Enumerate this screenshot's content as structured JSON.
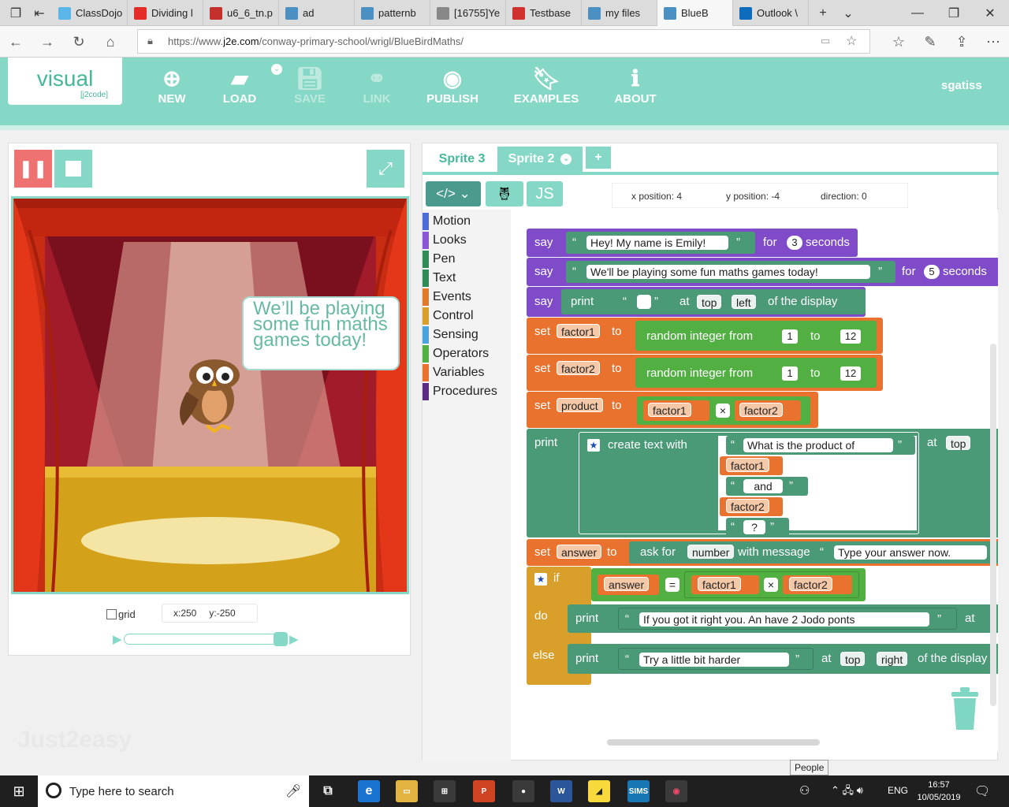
{
  "browser": {
    "tabs": [
      {
        "label": "ClassDojo",
        "icon": "classdojo-icon",
        "color": "#5ab6e8"
      },
      {
        "label": "Dividing l",
        "icon": "youtube-icon",
        "color": "#e52d27"
      },
      {
        "label": "u6_6_tn.p",
        "icon": "pdf-icon",
        "color": "#c4302b"
      },
      {
        "label": "ad",
        "icon": "j2e-icon",
        "color": "#4a90c2"
      },
      {
        "label": "patternb",
        "icon": "j2e-icon",
        "color": "#4a90c2"
      },
      {
        "label": "[16755]Ye",
        "icon": "page-icon",
        "color": "#888888"
      },
      {
        "label": "Testbase",
        "icon": "testbase-icon",
        "color": "#d0312d"
      },
      {
        "label": "my files",
        "icon": "j2e-icon",
        "color": "#4a90c2"
      },
      {
        "label": "BlueB",
        "icon": "j2e-icon",
        "color": "#4a90c2"
      },
      {
        "label": "Outlook \\",
        "icon": "outlook-icon",
        "color": "#0f6cbd"
      }
    ],
    "url_prefix": "https://www.",
    "url_domain": "j2e.com",
    "url_path": "/conway-primary-school/wrigl/BlueBirdMaths/"
  },
  "app": {
    "logo_main": "visual",
    "logo_sub": "[j2code]",
    "nav": [
      {
        "label": "NEW",
        "icon": "plus-circle-icon",
        "enabled": true
      },
      {
        "label": "LOAD",
        "icon": "folder-icon",
        "enabled": true
      },
      {
        "label": "SAVE",
        "icon": "save-icon",
        "enabled": false
      },
      {
        "label": "LINK",
        "icon": "link-icon",
        "enabled": false
      },
      {
        "label": "PUBLISH",
        "icon": "publish-icon",
        "enabled": true
      },
      {
        "label": "EXAMPLES",
        "icon": "bookmark-icon",
        "enabled": true
      },
      {
        "label": "ABOUT",
        "icon": "info-icon",
        "enabled": true
      }
    ],
    "username": "sgatiss",
    "accent": "#84d8c5"
  },
  "stage": {
    "speech": "We’ll be playing some fun maths games today!",
    "grid_label": "grid",
    "x_readout": "x:250",
    "y_readout": "y:-250",
    "watermark": "Just2easy"
  },
  "editor": {
    "sprite_tabs": [
      "Sprite 3",
      "Sprite 2"
    ],
    "add_tab": "+",
    "js_label": "JS",
    "x_position": "x position: 4",
    "y_position": "y position: -4",
    "direction": "direction: 0",
    "categories": [
      {
        "label": "Motion",
        "color": "#4a6cd4"
      },
      {
        "label": "Looks",
        "color": "#8a55d7"
      },
      {
        "label": "Pen",
        "color": "#2e8b57"
      },
      {
        "label": "Text",
        "color": "#2e8b57"
      },
      {
        "label": "Events",
        "color": "#e07b2c"
      },
      {
        "label": "Control",
        "color": "#d99f2b"
      },
      {
        "label": "Sensing",
        "color": "#4aa3df"
      },
      {
        "label": "Operators",
        "color": "#52b043"
      },
      {
        "label": "Variables",
        "color": "#e8722e"
      },
      {
        "label": "Procedures",
        "color": "#5b2c83"
      }
    ],
    "people_tooltip": "People"
  },
  "blocks": {
    "say": "say",
    "for": "for",
    "seconds": "seconds",
    "say1_text": "Hey! My name is Emily!",
    "say1_secs": "3",
    "say2_text": "We'll be playing some fun maths games today!",
    "say2_secs": "5",
    "print": "print",
    "at": "at",
    "top": "top",
    "left": "left",
    "right": "right",
    "of_display": "of the display",
    "set": "set",
    "to": "to",
    "factor1": "factor1",
    "factor2": "factor2",
    "product": "product",
    "answer": "answer",
    "random_int": "random integer from",
    "r_from": "1",
    "r_to": "12",
    "times": "×",
    "equals": "=",
    "create_text": "create text with",
    "t1": "What is the product of",
    "t2": "and",
    "t3": "?",
    "ask_for": "ask for",
    "number": "number",
    "with_message": "with message",
    "ask_text": "Type your answer now.",
    "if": "if",
    "do": "do",
    "else": "else",
    "right_msg": "If you got it right you. An have 2 Jodo ponts",
    "wrong_msg": "Try a little bit harder",
    "quote_open": "“",
    "quote_close": "”"
  },
  "taskbar": {
    "search_placeholder": "Type here to search",
    "lang": "ENG",
    "time": "16:57",
    "date": "10/05/2019"
  }
}
